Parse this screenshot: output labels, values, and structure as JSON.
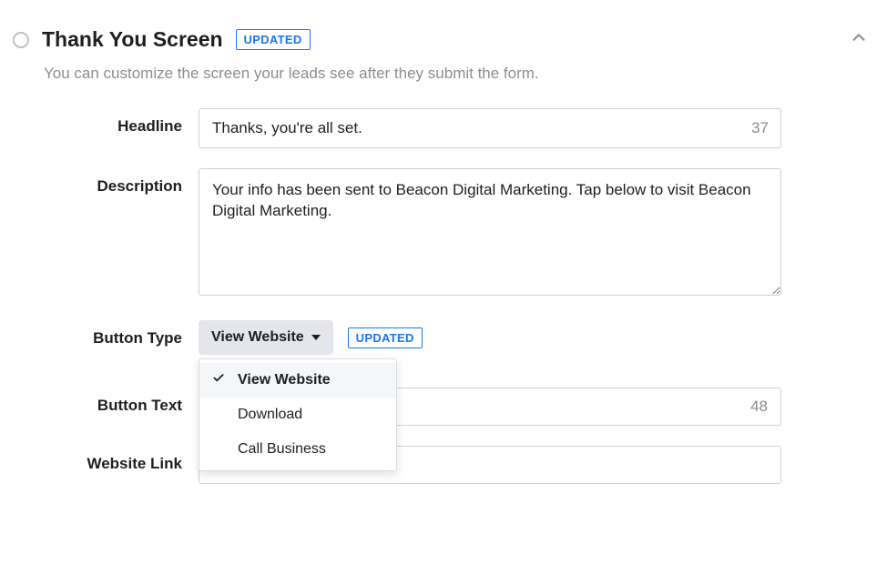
{
  "section": {
    "title": "Thank You Screen",
    "badge": "UPDATED",
    "description": "You can customize the screen your leads see after they submit the form."
  },
  "form": {
    "headline": {
      "label": "Headline",
      "value": "Thanks, you're all set.",
      "remaining": "37"
    },
    "description": {
      "label": "Description",
      "value": "Your info has been sent to Beacon Digital Marketing. Tap below to visit Beacon Digital Marketing."
    },
    "buttonType": {
      "label": "Button Type",
      "selected": "View Website",
      "badge": "UPDATED",
      "options": [
        "View Website",
        "Download",
        "Call Business"
      ]
    },
    "buttonText": {
      "label": "Button Text",
      "remaining": "48"
    },
    "websiteLink": {
      "label": "Website Link"
    }
  }
}
